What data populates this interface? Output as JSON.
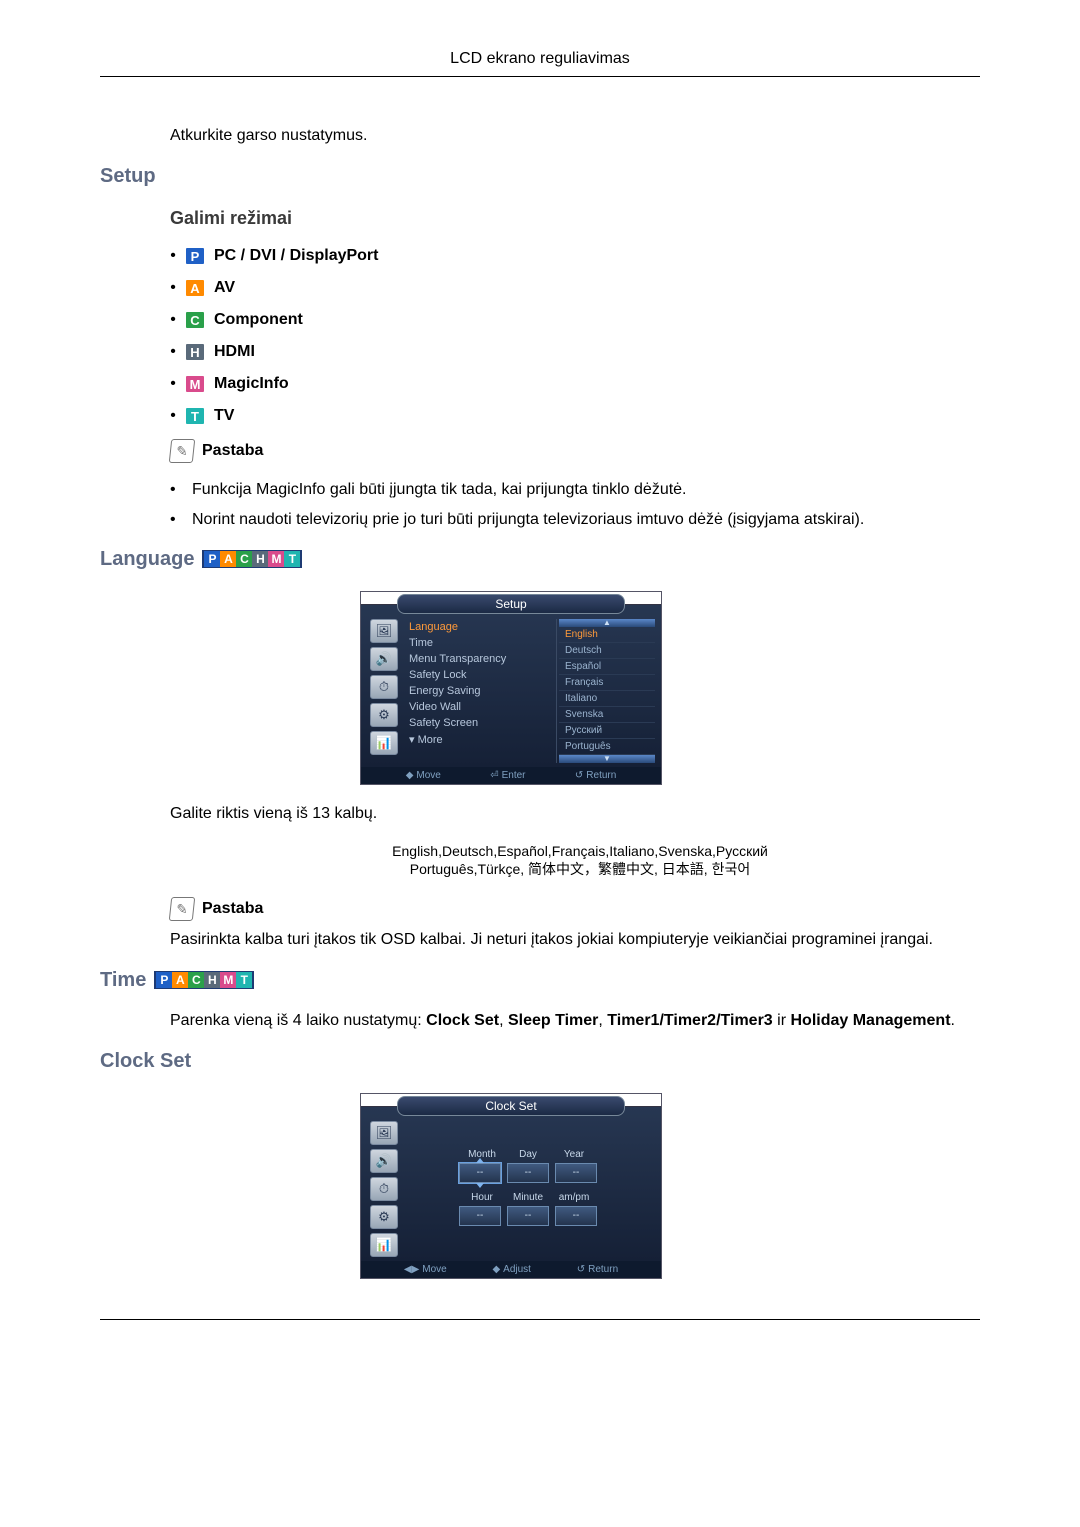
{
  "header": {
    "title": "LCD ekrano reguliavimas"
  },
  "intro": "Atkurkite garso nustatymus.",
  "setup": {
    "title": "Setup",
    "modes_title": "Galimi režimai",
    "modes": [
      {
        "letter": "P",
        "bg": "#1f60c6",
        "label": "PC / DVI / DisplayPort"
      },
      {
        "letter": "A",
        "bg": "#ff8a00",
        "label": "AV"
      },
      {
        "letter": "C",
        "bg": "#2aa04a",
        "label": "Component"
      },
      {
        "letter": "H",
        "bg": "#5a6a7a",
        "label": "HDMI"
      },
      {
        "letter": "M",
        "bg": "#d94b8c",
        "label": "MagicInfo"
      },
      {
        "letter": "T",
        "bg": "#1fb5b0",
        "label": "TV"
      }
    ],
    "note_label": "Pastaba",
    "notes": [
      "Funkcija MagicInfo gali būti įjungta tik tada, kai prijungta tinklo dėžutė.",
      "Norint naudoti televizorių prie jo turi būti prijungta televizoriaus imtuvo dėžė (įsigyjama atskirai)."
    ]
  },
  "badge_colors": {
    "P": "#1f60c6",
    "A": "#ff8a00",
    "C": "#2aa04a",
    "H": "#5a6a7a",
    "M": "#d94b8c",
    "T": "#1fb5b0"
  },
  "language": {
    "title": "Language",
    "osd": {
      "title": "Setup",
      "menu": [
        {
          "label": "Language",
          "selected": true
        },
        {
          "label": "Time"
        },
        {
          "label": "Menu Transparency"
        },
        {
          "label": "Safety Lock"
        },
        {
          "label": "Energy Saving"
        },
        {
          "label": "Video Wall"
        },
        {
          "label": "Safety Screen"
        },
        {
          "label": "▾ More"
        }
      ],
      "langs": [
        {
          "label": "English",
          "selected": true
        },
        {
          "label": "Deutsch"
        },
        {
          "label": "Español"
        },
        {
          "label": "Français"
        },
        {
          "label": "Italiano"
        },
        {
          "label": "Svenska"
        },
        {
          "label": "Русский"
        },
        {
          "label": "Português"
        }
      ],
      "hints": {
        "move": "Move",
        "enter": "Enter",
        "return": "Return"
      }
    },
    "text": "Galite riktis vieną iš 13 kalbų.",
    "lang_list_1": "English,Deutsch,Español,Français,Italiano,Svenska,Русский",
    "lang_list_2": "Português,Türkçe, 简体中文，繁體中文, 日本語, 한국어",
    "note_label": "Pastaba",
    "note_text": "Pasirinkta kalba turi įtakos tik OSD kalbai. Ji neturi įtakos jokiai kompiuteryje veikiančiai programinei įrangai."
  },
  "time": {
    "title": "Time",
    "intro_pre": "Parenka vieną iš 4 laiko nustatymų: ",
    "opt1": "Clock Set",
    "opt2": "Sleep Timer",
    "opt3": "Timer1/Timer2/Timer3",
    "opt_and": " ir ",
    "opt4": "Holiday Management",
    "opt_sep": ", "
  },
  "clockset": {
    "title": "Clock Set",
    "osd": {
      "title": "Clock Set",
      "labels": {
        "month": "Month",
        "day": "Day",
        "year": "Year",
        "hour": "Hour",
        "minute": "Minute",
        "ampm": "am/pm"
      },
      "values": {
        "month": "--",
        "day": "--",
        "year": "--",
        "hour": "--",
        "minute": "--",
        "ampm": "--"
      },
      "hints": {
        "move": "Move",
        "adjust": "Adjust",
        "return": "Return"
      }
    }
  },
  "icons": {
    "osd_side": [
      "🖼",
      "🔊",
      "⏱",
      "⚙",
      "📊"
    ]
  }
}
